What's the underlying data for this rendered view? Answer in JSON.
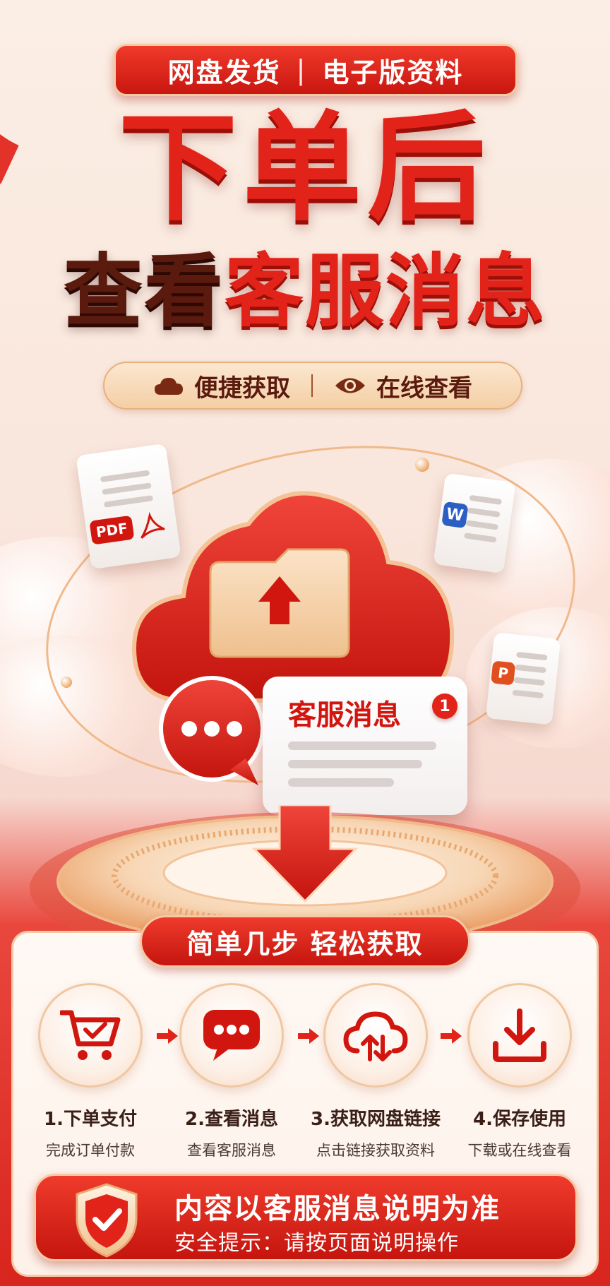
{
  "top_banner": {
    "left_text": "网盘发货",
    "separator": "|",
    "right_text": "电子版资料"
  },
  "headline": {
    "line1": "下单后",
    "line2_dark": "查看",
    "line2_red": "客服消息"
  },
  "features": {
    "item1": {
      "icon": "cloud-icon",
      "label": "便捷获取"
    },
    "separator": "|",
    "item2": {
      "icon": "eye-icon",
      "label": "在线查看"
    }
  },
  "illustration": {
    "doc_pdf_badge": "PDF",
    "doc_word_badge": "W",
    "doc_ppt_badge": "P",
    "message_card_title": "客服消息",
    "message_badge_count": "1"
  },
  "steps_section": {
    "title": "简单几步 轻松获取",
    "steps": [
      {
        "icon": "shopping-cart-icon",
        "title": "1.下单支付",
        "desc": "完成订单付款"
      },
      {
        "icon": "chat-bubble-icon",
        "title": "2.查看消息",
        "desc": "查看客服消息"
      },
      {
        "icon": "cloud-transfer-icon",
        "title": "3.获取网盘链接",
        "desc": "点击链接获取资料"
      },
      {
        "icon": "download-icon",
        "title": "4.保存使用",
        "desc": "下载或在线查看"
      }
    ]
  },
  "notice": {
    "icon": "shield-check-icon",
    "main": "内容以客服消息说明为准",
    "sub": "安全提示：请按页面说明操作"
  },
  "colors": {
    "brand_red": "#e2231a",
    "dark_brown": "#5a1a0e",
    "gold": "#f4cfa5"
  }
}
